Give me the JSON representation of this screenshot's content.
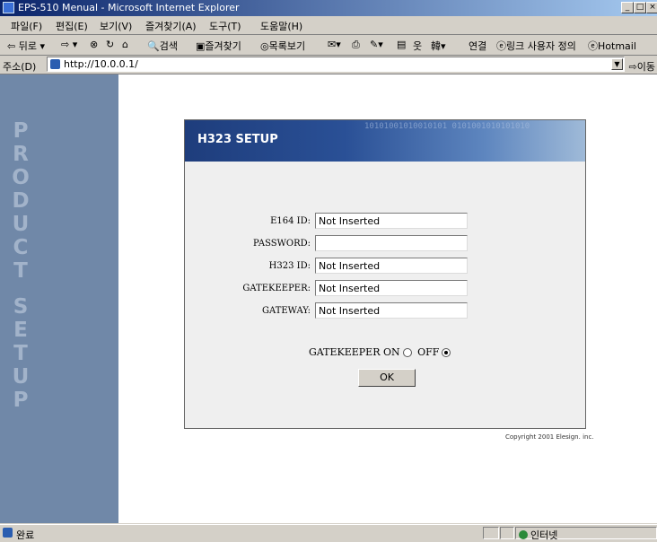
{
  "window": {
    "title": "EPS-510 Menual - Microsoft Internet Explorer"
  },
  "menubar": {
    "items": [
      "파일(F)",
      "편집(E)",
      "보기(V)",
      "즐겨찾기(A)",
      "도구(T)",
      "도움말(H)"
    ]
  },
  "toolbar": {
    "back": "뒤로",
    "search": "검색",
    "favorites": "즐겨찾기",
    "history": "목록보기",
    "links_label": "연결",
    "link_custom": "링크 사용자 정의",
    "link_hotmail": "Hotmail"
  },
  "address": {
    "label": "주소(D)",
    "url": "http://10.0.0.1/",
    "go": "이동"
  },
  "sidebar": {
    "text": "PRODUCT SETUP"
  },
  "panel": {
    "title": "H323 SETUP",
    "decoration": "10101001010010101 0101001010101010",
    "fields": [
      {
        "label": "E164 ID:",
        "value": "Not Inserted"
      },
      {
        "label": "PASSWORD:",
        "value": ""
      },
      {
        "label": "H323 ID:",
        "value": "Not Inserted"
      },
      {
        "label": "GATEKEEPER:",
        "value": "Not Inserted"
      },
      {
        "label": "GATEWAY:",
        "value": "Not Inserted"
      }
    ],
    "gatekeeper_label": "GATEKEEPER",
    "on_label": "ON",
    "off_label": "OFF",
    "selected": "OFF",
    "ok_label": "OK"
  },
  "copyright": "Copyright 2001 Elesign. inc.",
  "status": {
    "text": "완료",
    "zone": "인터넷"
  }
}
